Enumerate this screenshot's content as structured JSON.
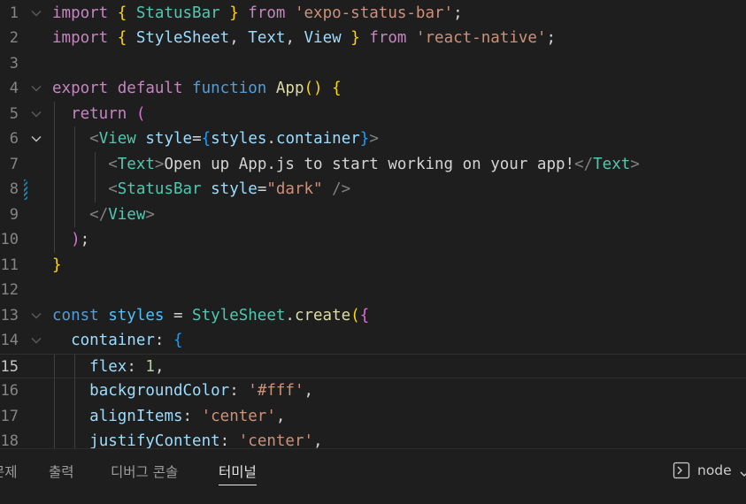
{
  "editor": {
    "current_line": 15,
    "lines": [
      {
        "n": "1",
        "fold": "open",
        "segs": [
          [
            "k",
            "import "
          ],
          [
            "b1",
            "{ "
          ],
          [
            "t",
            "StatusBar"
          ],
          [
            "b1",
            " }"
          ],
          [
            "k",
            " from "
          ],
          [
            "s",
            "'expo-status-bar'"
          ],
          [
            "p",
            ";"
          ]
        ]
      },
      {
        "n": "2",
        "segs": [
          [
            "k",
            "import "
          ],
          [
            "b1",
            "{ "
          ],
          [
            "v",
            "StyleSheet"
          ],
          [
            "p",
            ", "
          ],
          [
            "v",
            "Text"
          ],
          [
            "p",
            ", "
          ],
          [
            "v",
            "View"
          ],
          [
            "b1",
            " }"
          ],
          [
            "k",
            " from "
          ],
          [
            "s",
            "'react-native'"
          ],
          [
            "p",
            ";"
          ]
        ]
      },
      {
        "n": "3",
        "segs": []
      },
      {
        "n": "4",
        "fold": "open",
        "segs": [
          [
            "k",
            "export default "
          ],
          [
            "kw",
            "function "
          ],
          [
            "f",
            "App"
          ],
          [
            "b1",
            "()"
          ],
          [
            "p",
            " "
          ],
          [
            "b1",
            "{"
          ]
        ]
      },
      {
        "n": "5",
        "fold": "open",
        "segs": [
          [
            "p",
            "  "
          ],
          [
            "k",
            "return "
          ],
          [
            "b2",
            "("
          ]
        ]
      },
      {
        "n": "6",
        "fold": "open-strong",
        "segs": [
          [
            "p",
            "    "
          ],
          [
            "g",
            "<"
          ],
          [
            "t",
            "View "
          ],
          [
            "v",
            "style"
          ],
          [
            "p",
            "="
          ],
          [
            "b3",
            "{"
          ],
          [
            "v",
            "styles"
          ],
          [
            "p",
            "."
          ],
          [
            "v",
            "container"
          ],
          [
            "b3",
            "}"
          ],
          [
            "g",
            ">"
          ]
        ]
      },
      {
        "n": "7",
        "segs": [
          [
            "p",
            "      "
          ],
          [
            "g",
            "<"
          ],
          [
            "t",
            "Text"
          ],
          [
            "g",
            ">"
          ],
          [
            "p",
            "Open up App.js to start working on your app!"
          ],
          [
            "g",
            "</"
          ],
          [
            "t",
            "Text"
          ],
          [
            "g",
            ">"
          ]
        ]
      },
      {
        "n": "8",
        "mod": true,
        "segs": [
          [
            "p",
            "      "
          ],
          [
            "g",
            "<"
          ],
          [
            "t",
            "StatusBar "
          ],
          [
            "v",
            "style"
          ],
          [
            "p",
            "="
          ],
          [
            "s",
            "\"dark\""
          ],
          [
            "p",
            " "
          ],
          [
            "g",
            "/>"
          ]
        ]
      },
      {
        "n": "9",
        "segs": [
          [
            "p",
            "    "
          ],
          [
            "g",
            "</"
          ],
          [
            "t",
            "View"
          ],
          [
            "g",
            ">"
          ]
        ]
      },
      {
        "n": "10",
        "segs": [
          [
            "p",
            "  "
          ],
          [
            "b2",
            ")"
          ],
          [
            "p",
            ";"
          ]
        ]
      },
      {
        "n": "11",
        "segs": [
          [
            "b1",
            "}"
          ]
        ]
      },
      {
        "n": "12",
        "segs": []
      },
      {
        "n": "13",
        "fold": "open",
        "segs": [
          [
            "kw",
            "const "
          ],
          [
            "c",
            "styles"
          ],
          [
            "p",
            " = "
          ],
          [
            "t",
            "StyleSheet"
          ],
          [
            "p",
            "."
          ],
          [
            "f",
            "create"
          ],
          [
            "b1",
            "("
          ],
          [
            "b2",
            "{"
          ]
        ]
      },
      {
        "n": "14",
        "fold": "open",
        "segs": [
          [
            "p",
            "  "
          ],
          [
            "v",
            "container"
          ],
          [
            "p",
            ": "
          ],
          [
            "b3",
            "{"
          ]
        ]
      },
      {
        "n": "15",
        "segs": [
          [
            "p",
            "    "
          ],
          [
            "v",
            "flex"
          ],
          [
            "p",
            ": "
          ],
          [
            "n",
            "1"
          ],
          [
            "p",
            ","
          ]
        ]
      },
      {
        "n": "16",
        "segs": [
          [
            "p",
            "    "
          ],
          [
            "v",
            "backgroundColor"
          ],
          [
            "p",
            ": "
          ],
          [
            "s",
            "'#fff'"
          ],
          [
            "p",
            ","
          ]
        ]
      },
      {
        "n": "17",
        "segs": [
          [
            "p",
            "    "
          ],
          [
            "v",
            "alignItems"
          ],
          [
            "p",
            ": "
          ],
          [
            "s",
            "'center'"
          ],
          [
            "p",
            ","
          ]
        ]
      },
      {
        "n": "18",
        "segs": [
          [
            "p",
            "    "
          ],
          [
            "v",
            "justifyContent"
          ],
          [
            "p",
            ": "
          ],
          [
            "s",
            "'center'"
          ],
          [
            "p",
            ","
          ]
        ]
      }
    ]
  },
  "panel": {
    "tabs": [
      {
        "label": "문제",
        "active": false
      },
      {
        "label": "출력",
        "active": false
      },
      {
        "label": "디버그 콘솔",
        "active": false
      },
      {
        "label": "터미널",
        "active": true
      }
    ],
    "terminal": {
      "icon": "terminal-icon",
      "name": "node"
    }
  },
  "colors": {
    "background": "#1e1e1e",
    "accent": "#e7e7e7"
  }
}
